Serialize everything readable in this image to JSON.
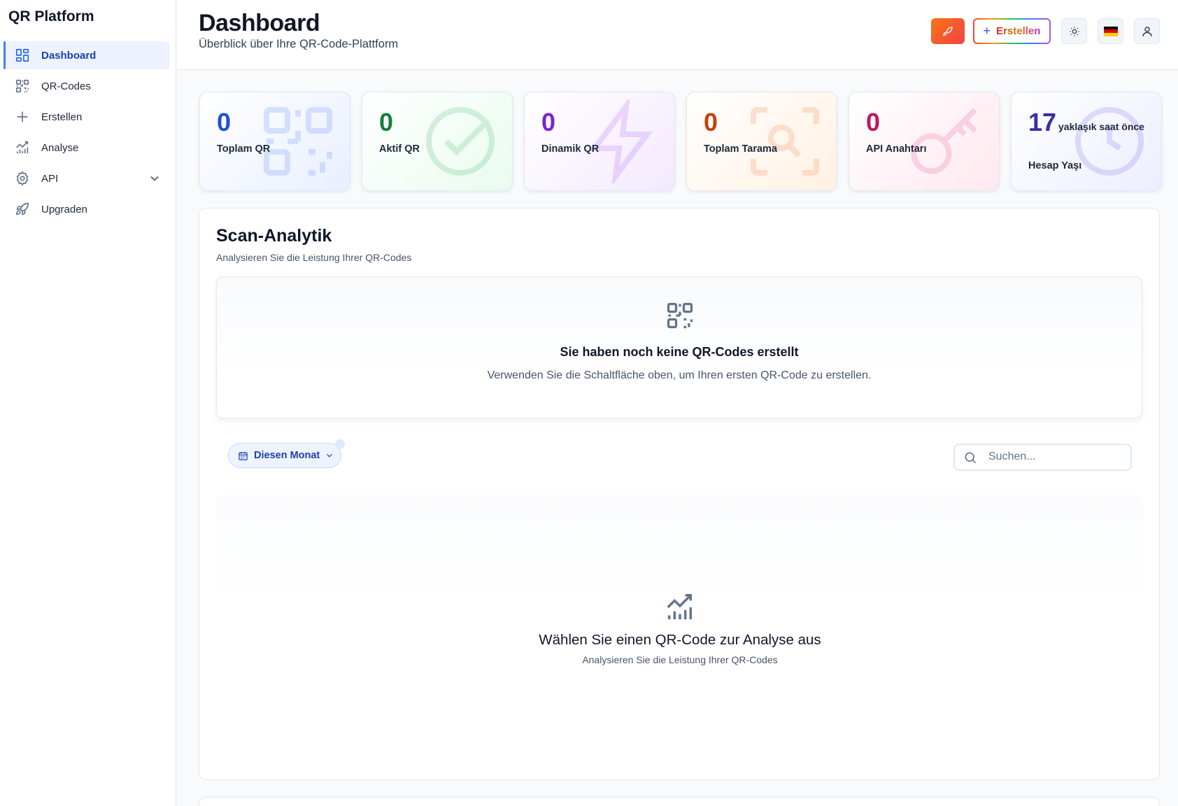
{
  "app": {
    "brand": "QR Platform"
  },
  "sidebar": {
    "items": [
      {
        "label": "Dashboard",
        "icon": "dashboard-icon",
        "active": true
      },
      {
        "label": "QR-Codes",
        "icon": "qr-code-icon"
      },
      {
        "label": "Erstellen",
        "icon": "plus-icon"
      },
      {
        "label": "Analyse",
        "icon": "chart-icon"
      },
      {
        "label": "API",
        "icon": "gear-icon",
        "expandable": true
      },
      {
        "label": "Upgraden",
        "icon": "rocket-icon"
      }
    ]
  },
  "header": {
    "title": "Dashboard",
    "subtitle": "Überblick über Ihre QR-Code-Plattform",
    "create_label": "Erstellen",
    "language": "de"
  },
  "stats": [
    {
      "value": "0",
      "label": "Toplam QR",
      "color": "#1d4ed8"
    },
    {
      "value": "0",
      "label": "Aktif QR",
      "color": "#15803d"
    },
    {
      "value": "0",
      "label": "Dinamik QR",
      "color": "#7e22ce"
    },
    {
      "value": "0",
      "label": "Toplam Tarama",
      "color": "#c2410c"
    },
    {
      "value": "0",
      "label": "API Anahtarı",
      "color": "#be185d"
    },
    {
      "value": "17",
      "unit": "yaklaşık saat önce",
      "label": "Hesap Yaşı",
      "color": "#3730a3"
    }
  ],
  "analytics": {
    "title": "Scan-Analytik",
    "subtitle": "Analysieren Sie die Leistung Ihrer QR-Codes",
    "empty_title": "Sie haben noch keine QR-Codes erstellt",
    "empty_text": "Verwenden Sie die Schaltfläche oben, um Ihren ersten QR-Code zu erstellen.",
    "period_label": "Diesen Monat",
    "search_placeholder": "Suchen...",
    "chart_empty_title": "Wählen Sie einen QR-Code zur Analyse aus",
    "chart_empty_sub": "Analysieren Sie die Leistung Ihrer QR-Codes"
  }
}
